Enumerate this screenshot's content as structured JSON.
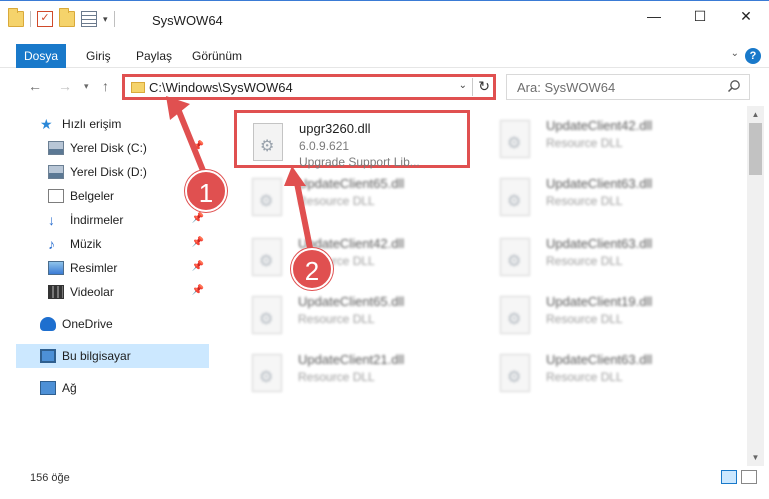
{
  "window": {
    "title": "SysWOW64",
    "minimize_glyph": "—",
    "maximize_glyph": "☐",
    "close_glyph": "✕"
  },
  "ribbon": {
    "tabs": [
      {
        "label": "Dosya",
        "active": true
      },
      {
        "label": "Giriş"
      },
      {
        "label": "Paylaş"
      },
      {
        "label": "Görünüm"
      }
    ]
  },
  "nav": {
    "address_path": "C:\\Windows\\SysWOW64",
    "search_placeholder": "Ara: SysWOW64"
  },
  "sidebar": {
    "items": [
      {
        "label": "Hızlı erişim",
        "icon": "star-icon"
      },
      {
        "label": "Yerel Disk (C:)",
        "icon": "drive-icon",
        "pinned": true
      },
      {
        "label": "Yerel Disk (D:)",
        "icon": "drive-icon"
      },
      {
        "label": "Belgeler",
        "icon": "documents-icon"
      },
      {
        "label": "İndirmeler",
        "icon": "downloads-icon",
        "pinned": true
      },
      {
        "label": "Müzik",
        "icon": "music-icon",
        "pinned": true
      },
      {
        "label": "Resimler",
        "icon": "pictures-icon",
        "pinned": true
      },
      {
        "label": "Videolar",
        "icon": "videos-icon",
        "pinned": true
      },
      {
        "label": "OneDrive",
        "icon": "onedrive-icon"
      },
      {
        "label": "Bu bilgisayar",
        "icon": "this-pc-icon",
        "selected": true
      },
      {
        "label": "Ağ",
        "icon": "network-icon"
      }
    ]
  },
  "files": [
    {
      "name": "upgr3260.dll",
      "line1": "6.0.9.621",
      "line2": "Upgrade Support Lib...",
      "highlighted": true
    },
    {
      "name": "UpdateClient42.dll",
      "line1": "Resource DLL"
    },
    {
      "name": "UpdateClient65.dll",
      "line1": "Resource DLL"
    },
    {
      "name": "UpdateClient63.dll",
      "line1": "Resource DLL"
    },
    {
      "name": "UpdateClient42.dll",
      "line1": "Resource DLL"
    },
    {
      "name": "UpdateClient63.dll",
      "line1": "Resource DLL"
    },
    {
      "name": "UpdateClient65.dll",
      "line1": "Resource DLL"
    },
    {
      "name": "UpdateClient19.dll",
      "line1": "Resource DLL"
    },
    {
      "name": "UpdateClient21.dll",
      "line1": "Resource DLL"
    },
    {
      "name": "UpdateClient63.dll",
      "line1": "Resource DLL"
    }
  ],
  "status": {
    "item_count": "156 öğe"
  },
  "annotations": {
    "marker1": "1",
    "marker2": "2",
    "color": "#e05050"
  }
}
